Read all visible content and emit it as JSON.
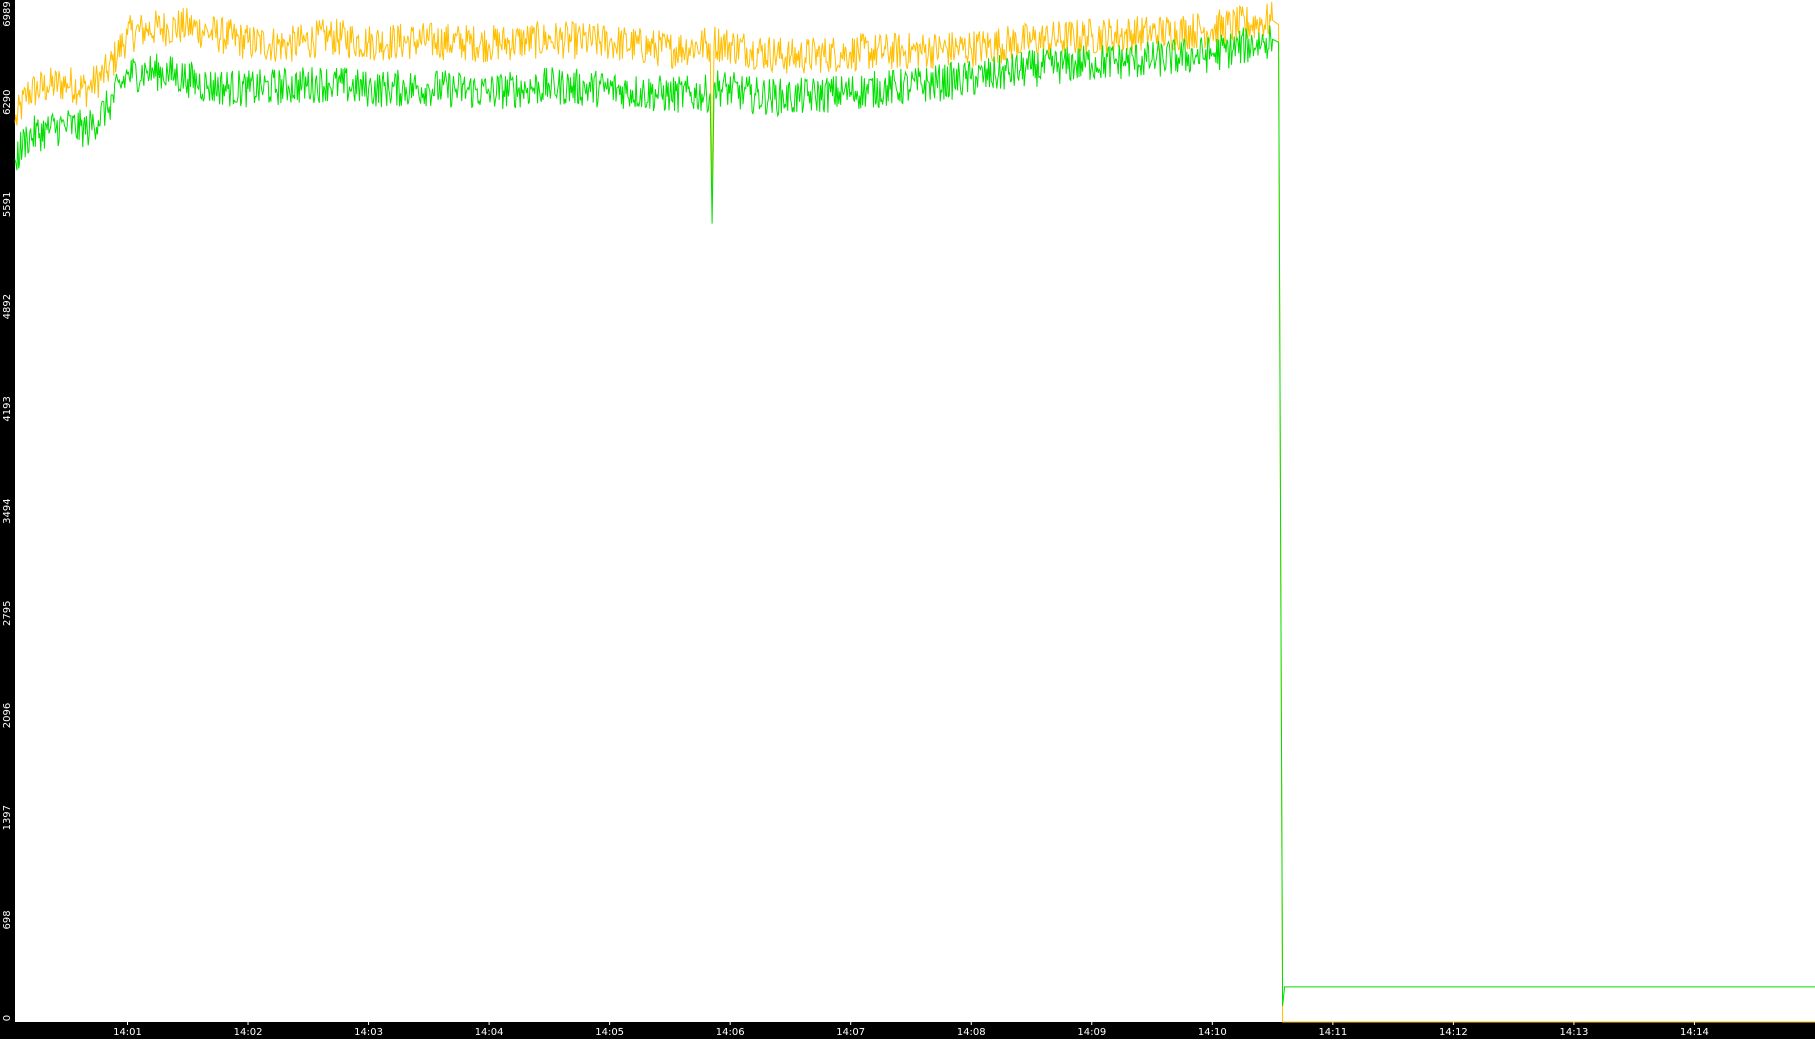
{
  "chart_data": {
    "type": "line",
    "title": "",
    "xlabel": "",
    "ylabel": "",
    "x_ticks": [
      "14:01",
      "14:02",
      "14:03",
      "14:04",
      "14:05",
      "14:06",
      "14:07",
      "14:08",
      "14:09",
      "14:10",
      "14:11",
      "14:12",
      "14:13",
      "14:14"
    ],
    "y_ticks": [
      "0",
      "698",
      "1397",
      "2096",
      "2795",
      "3494",
      "4193",
      "4892",
      "5591",
      "6290",
      "6989"
    ],
    "xlim": [
      "14:00:04",
      "14:15:00"
    ],
    "ylim": [
      0,
      6989
    ],
    "grid": false,
    "background": "#ffffff",
    "axis_band_color": "#000000",
    "tick_label_color": "#ffffff",
    "series": [
      {
        "color": "#ffbf00",
        "points": [
          [
            "14:00:04",
            6150
          ],
          [
            "14:00:10",
            6350
          ],
          [
            "14:00:20",
            6400
          ],
          [
            "14:00:30",
            6420
          ],
          [
            "14:00:40",
            6380
          ],
          [
            "14:00:50",
            6500
          ],
          [
            "14:01:00",
            6750
          ],
          [
            "14:01:10",
            6790
          ],
          [
            "14:01:20",
            6800
          ],
          [
            "14:01:30",
            6810
          ],
          [
            "14:01:40",
            6770
          ],
          [
            "14:02:00",
            6700
          ],
          [
            "14:02:20",
            6680
          ],
          [
            "14:02:40",
            6740
          ],
          [
            "14:03:00",
            6700
          ],
          [
            "14:03:30",
            6710
          ],
          [
            "14:04:00",
            6690
          ],
          [
            "14:04:30",
            6720
          ],
          [
            "14:05:00",
            6700
          ],
          [
            "14:05:30",
            6650
          ],
          [
            "14:05:50",
            6690
          ],
          [
            "14:05:51",
            5700
          ],
          [
            "14:05:52",
            6700
          ],
          [
            "14:06:10",
            6650
          ],
          [
            "14:06:30",
            6600
          ],
          [
            "14:07:00",
            6630
          ],
          [
            "14:07:30",
            6640
          ],
          [
            "14:08:00",
            6660
          ],
          [
            "14:08:30",
            6710
          ],
          [
            "14:09:00",
            6740
          ],
          [
            "14:09:30",
            6760
          ],
          [
            "14:10:00",
            6790
          ],
          [
            "14:10:30",
            6850
          ],
          [
            "14:10:33",
            6820
          ],
          [
            "14:10:34",
            3300
          ],
          [
            "14:10:35",
            0
          ],
          [
            "14:15:00",
            0
          ]
        ]
      },
      {
        "color": "#00e000",
        "points": [
          [
            "14:00:04",
            5900
          ],
          [
            "14:00:10",
            6050
          ],
          [
            "14:00:20",
            6100
          ],
          [
            "14:00:30",
            6130
          ],
          [
            "14:00:40",
            6100
          ],
          [
            "14:00:50",
            6250
          ],
          [
            "14:01:00",
            6480
          ],
          [
            "14:01:10",
            6500
          ],
          [
            "14:01:20",
            6490
          ],
          [
            "14:01:30",
            6450
          ],
          [
            "14:01:40",
            6400
          ],
          [
            "14:02:00",
            6380
          ],
          [
            "14:02:20",
            6400
          ],
          [
            "14:02:40",
            6420
          ],
          [
            "14:03:00",
            6380
          ],
          [
            "14:03:30",
            6390
          ],
          [
            "14:04:00",
            6360
          ],
          [
            "14:04:30",
            6400
          ],
          [
            "14:05:00",
            6380
          ],
          [
            "14:05:30",
            6340
          ],
          [
            "14:05:50",
            6350
          ],
          [
            "14:05:51",
            5460
          ],
          [
            "14:05:52",
            6400
          ],
          [
            "14:06:10",
            6340
          ],
          [
            "14:06:30",
            6320
          ],
          [
            "14:07:00",
            6360
          ],
          [
            "14:07:30",
            6400
          ],
          [
            "14:08:00",
            6450
          ],
          [
            "14:08:30",
            6520
          ],
          [
            "14:09:00",
            6560
          ],
          [
            "14:09:30",
            6580
          ],
          [
            "14:10:00",
            6620
          ],
          [
            "14:10:30",
            6720
          ],
          [
            "14:10:33",
            6700
          ],
          [
            "14:10:34",
            3360
          ],
          [
            "14:10:35",
            110
          ],
          [
            "14:10:36",
            240
          ],
          [
            "14:15:00",
            240
          ]
        ]
      }
    ]
  }
}
